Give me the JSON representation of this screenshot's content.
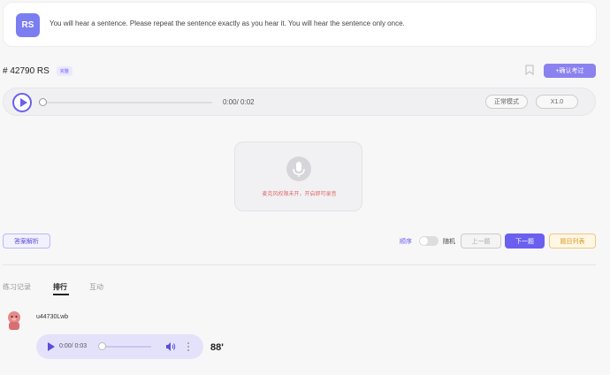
{
  "instruction": {
    "badge": "RS",
    "text": "You will hear a sentence. Please repeat the sentence exactly as you hear it. You will hear the sentence only once."
  },
  "question": {
    "title": "# 42790 RS",
    "tag": "完整",
    "confirm_label": "+确认考过"
  },
  "player": {
    "time": "0:00/ 0:02",
    "mode_label": "正常模式",
    "speed_label": "X1.0",
    "progress": 0
  },
  "recorder": {
    "message": "麦克风权限未开，开启即可录音"
  },
  "controls": {
    "analysis_label": "答案解析",
    "order_label": "顺序",
    "random_label": "随机",
    "prev_label": "上一题",
    "next_label": "下一题",
    "list_label": "题目列表"
  },
  "tabs": [
    {
      "label": "练习记录",
      "active": false
    },
    {
      "label": "排行",
      "active": true
    },
    {
      "label": "互动",
      "active": false
    }
  ],
  "entry": {
    "username": "u44730Lwb",
    "time": "0:00/ 0:03",
    "score": "88'"
  },
  "colors": {
    "accent": "#6b5ff0",
    "warning_text": "#e06a6a",
    "list_button": "#d89a22"
  }
}
